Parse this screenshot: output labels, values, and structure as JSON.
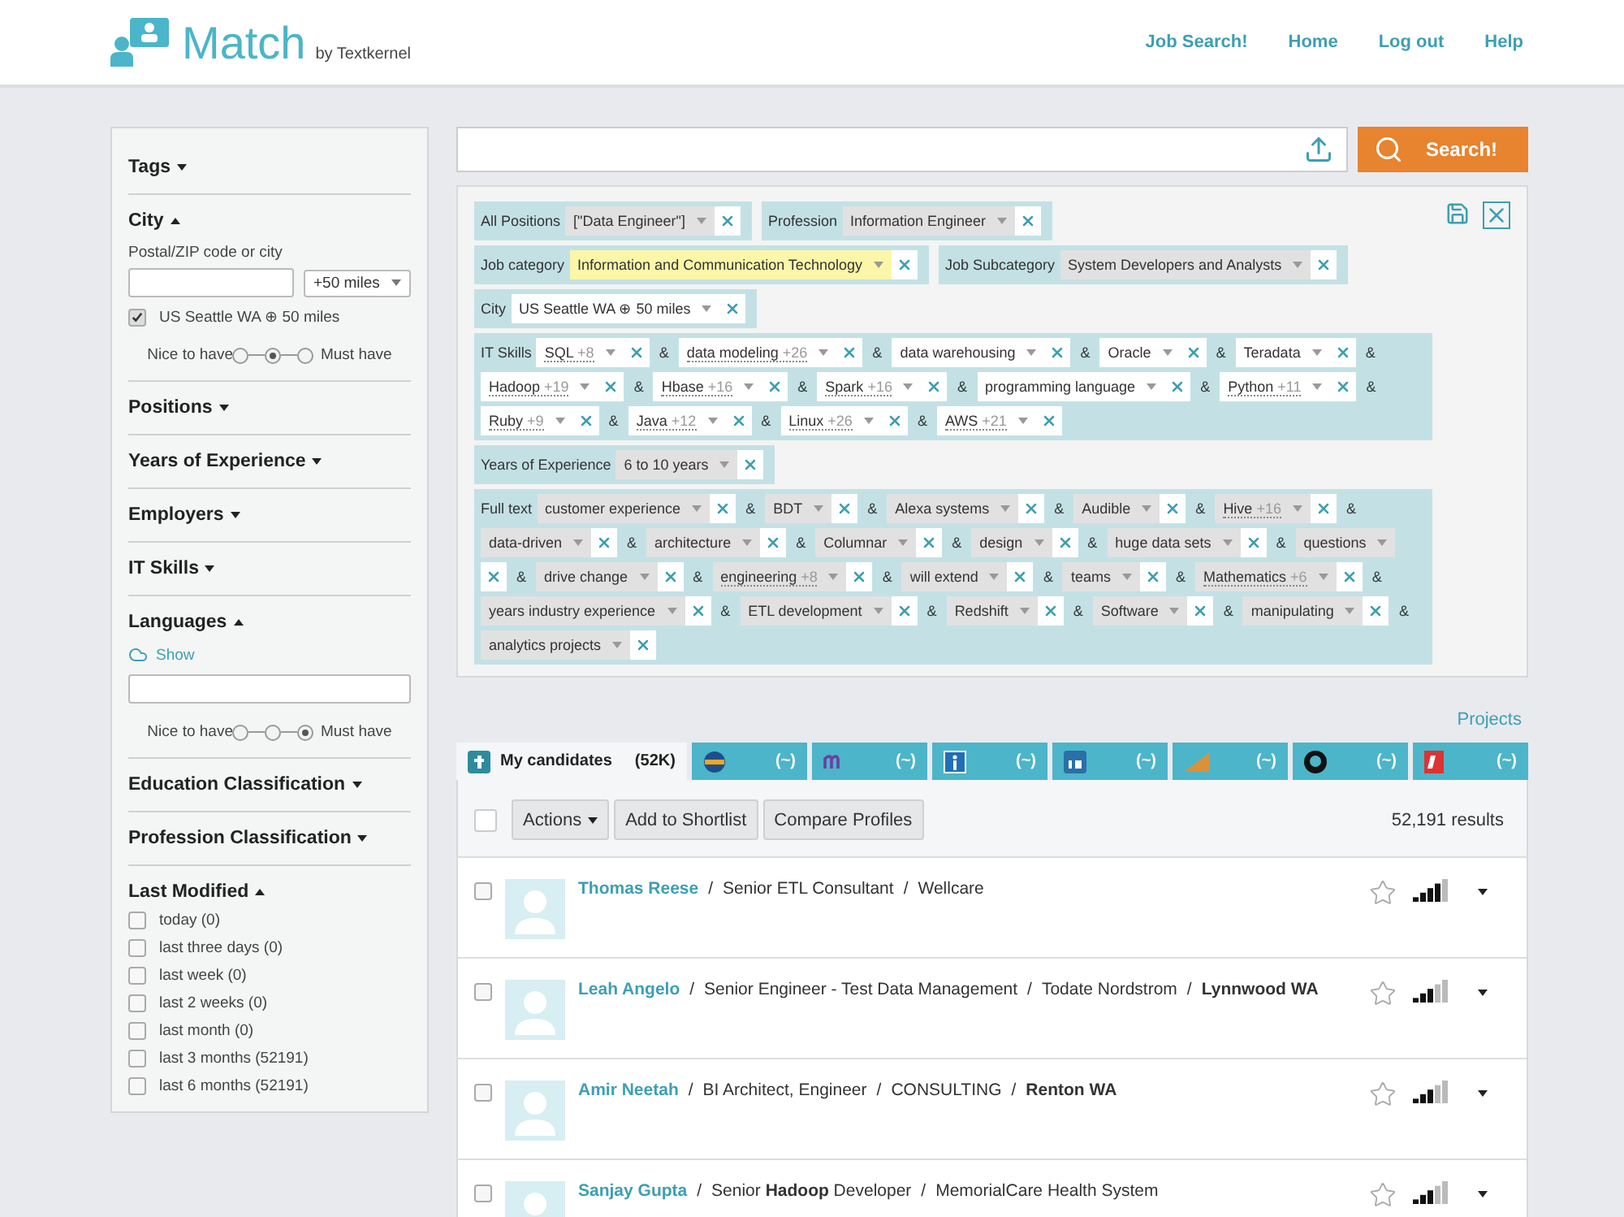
{
  "header": {
    "logo": "Match",
    "byline": "by Textkernel",
    "nav": [
      "Job Search!",
      "Home",
      "Log out",
      "Help"
    ]
  },
  "sidebar": [
    {
      "kind": "plain",
      "title": "Tags",
      "expanded": false
    },
    {
      "kind": "city",
      "title": "City",
      "expanded": true,
      "field_label": "Postal/ZIP code or city",
      "radius": "+50 miles",
      "options": [
        {
          "label": "US Seattle WA ⊕ 50 miles",
          "checked": true
        }
      ],
      "weight": {
        "left": "Nice to have",
        "right": "Must have",
        "stops": [
          {
            "selected": false
          },
          {
            "selected": true
          },
          {
            "selected": false
          }
        ]
      }
    },
    {
      "kind": "plain",
      "title": "Positions",
      "expanded": false
    },
    {
      "kind": "plain",
      "title": "Years of Experience",
      "expanded": false
    },
    {
      "kind": "plain",
      "title": "Employers",
      "expanded": false
    },
    {
      "kind": "plain",
      "title": "IT Skills",
      "expanded": false
    },
    {
      "kind": "languages",
      "title": "Languages",
      "expanded": true,
      "link": "Show",
      "weight": {
        "left": "Nice to have",
        "right": "Must have",
        "stops": [
          {
            "selected": false
          },
          {
            "selected": false
          },
          {
            "selected": true
          }
        ]
      }
    },
    {
      "kind": "plain",
      "title": "Education Classification",
      "expanded": false
    },
    {
      "kind": "plain",
      "title": "Profession Classification",
      "expanded": false
    },
    {
      "kind": "dates",
      "title": "Last Modified",
      "expanded": true,
      "options": [
        {
          "label": "today (0)",
          "checked": false
        },
        {
          "label": "last three days (0)",
          "checked": false
        },
        {
          "label": "last week (0)",
          "checked": false
        },
        {
          "label": "last 2 weeks (0)",
          "checked": false
        },
        {
          "label": "last month (0)",
          "checked": false
        },
        {
          "label": "last 3 months (52191)",
          "checked": false
        },
        {
          "label": "last 6 months (52191)",
          "checked": false
        }
      ]
    }
  ],
  "search": {
    "button": "Search!"
  },
  "query": {
    "groups": [
      {
        "label": "All Positions",
        "kind": "shaded",
        "terms": [
          {
            "text": "[\"Data Engineer\"]"
          }
        ]
      },
      {
        "label": "Profession",
        "kind": "shaded",
        "terms": [
          {
            "text": "Information Engineer"
          }
        ]
      },
      {
        "label": "Job category",
        "kind": "shaded",
        "terms": [
          {
            "text": "Information and Communication Technology",
            "highlighted": true
          }
        ]
      },
      {
        "label": "Job Subcategory",
        "kind": "shaded",
        "terms": [
          {
            "text": "System Developers and Analysts"
          }
        ]
      },
      {
        "label": "City",
        "kind": "plain",
        "terms": [
          {
            "text": "US Seattle WA ⊕ 50 miles"
          }
        ]
      },
      {
        "label": "IT Skills",
        "kind": "plain",
        "terms": [
          {
            "text": "SQL",
            "extra": "+8",
            "joiner": "&"
          },
          {
            "text": "data modeling",
            "extra": "+26",
            "joiner": "&"
          },
          {
            "text": "data warehousing",
            "joiner": "&"
          },
          {
            "text": "Oracle",
            "joiner": "&"
          },
          {
            "text": "Teradata",
            "joiner": "&"
          },
          {
            "text": "Hadoop",
            "extra": "+19",
            "joiner": "&"
          },
          {
            "text": "Hbase",
            "extra": "+16",
            "joiner": "&"
          },
          {
            "text": "Spark",
            "extra": "+16",
            "joiner": "&"
          },
          {
            "text": "programming language",
            "joiner": "&"
          },
          {
            "text": "Python",
            "extra": "+11",
            "joiner": "&"
          },
          {
            "text": "Ruby",
            "extra": "+9",
            "joiner": "&"
          },
          {
            "text": "Java",
            "extra": "+12",
            "joiner": "&"
          },
          {
            "text": "Linux",
            "extra": "+26",
            "joiner": "&"
          },
          {
            "text": "AWS",
            "extra": "+21"
          }
        ]
      },
      {
        "label": "Years of Experience",
        "kind": "shaded",
        "terms": [
          {
            "text": "6 to 10 years"
          }
        ]
      },
      {
        "label": "Full text",
        "kind": "shaded",
        "terms": [
          {
            "text": "customer experience",
            "joiner": "&"
          },
          {
            "text": "BDT",
            "joiner": "&"
          },
          {
            "text": "Alexa systems",
            "joiner": "&"
          },
          {
            "text": "Audible",
            "joiner": "&"
          },
          {
            "text": "Hive",
            "extra": "+16",
            "joiner": "&"
          },
          {
            "text": "data-driven",
            "joiner": "&"
          },
          {
            "text": "architecture",
            "joiner": "&"
          },
          {
            "text": "Columnar",
            "joiner": "&"
          },
          {
            "text": "design",
            "joiner": "&"
          },
          {
            "text": "huge data sets",
            "joiner": "&"
          },
          {
            "text": "questions",
            "joiner": "&"
          },
          {
            "text": "drive change",
            "joiner": "&"
          },
          {
            "text": "engineering",
            "extra": "+8",
            "joiner": "&"
          },
          {
            "text": "will extend",
            "joiner": "&"
          },
          {
            "text": "teams",
            "joiner": "&"
          },
          {
            "text": "Mathematics",
            "extra": "+6",
            "joiner": "&"
          },
          {
            "text": "years industry experience",
            "joiner": "&"
          },
          {
            "text": "ETL development",
            "joiner": "&"
          },
          {
            "text": "Redshift",
            "joiner": "&"
          },
          {
            "text": "Software",
            "joiner": "&"
          },
          {
            "text": "manipulating",
            "joiner": "&"
          },
          {
            "text": "analytics projects"
          }
        ]
      }
    ]
  },
  "projects_link": "Projects",
  "tabs": [
    {
      "label": "My candidates",
      "count": "(52K)",
      "selected": true
    },
    {
      "count": "(~)",
      "selected": false
    },
    {
      "count": "(~)",
      "selected": false
    },
    {
      "count": "(~)",
      "selected": false
    },
    {
      "count": "(~)",
      "selected": false
    },
    {
      "count": "(~)",
      "selected": false
    },
    {
      "count": "(~)",
      "selected": false
    },
    {
      "count": "(~)",
      "selected": false
    }
  ],
  "toolbar": {
    "select_all": false,
    "actions": "Actions",
    "buttons": [
      "Add to Shortlist",
      "Compare Profiles"
    ],
    "count": "52,191 results"
  },
  "candidates": [
    {
      "name": "Thomas Reese",
      "checked": false,
      "starred": false,
      "level": 0.8,
      "details": [
        {
          "sep": "/",
          "text": "Senior ETL Consultant"
        },
        {
          "sep": "/",
          "text": "Wellcare"
        }
      ]
    },
    {
      "name": "Leah Angelo",
      "checked": false,
      "starred": false,
      "level": 0.6,
      "details": [
        {
          "sep": "/",
          "text": "Senior Engineer - Test Data Management"
        },
        {
          "sep": "/",
          "text": "Todate Nordstrom"
        },
        {
          "sep": "/",
          "text": "Lynnwood WA",
          "bold": true
        }
      ]
    },
    {
      "name": "Amir Neetah",
      "checked": false,
      "starred": false,
      "level": 0.6,
      "details": [
        {
          "sep": "/",
          "text": "BI Architect, Engineer"
        },
        {
          "sep": "/",
          "text": "CONSULTING"
        },
        {
          "sep": "/",
          "text": "Renton WA",
          "bold": true
        }
      ]
    },
    {
      "name": "Sanjay Gupta",
      "checked": false,
      "starred": false,
      "level": 0.6,
      "details": [
        {
          "sep": "/",
          "text": "Senior **Hadoop** Developer"
        },
        {
          "sep": "/",
          "text": "MemorialCare Health System"
        }
      ]
    }
  ]
}
